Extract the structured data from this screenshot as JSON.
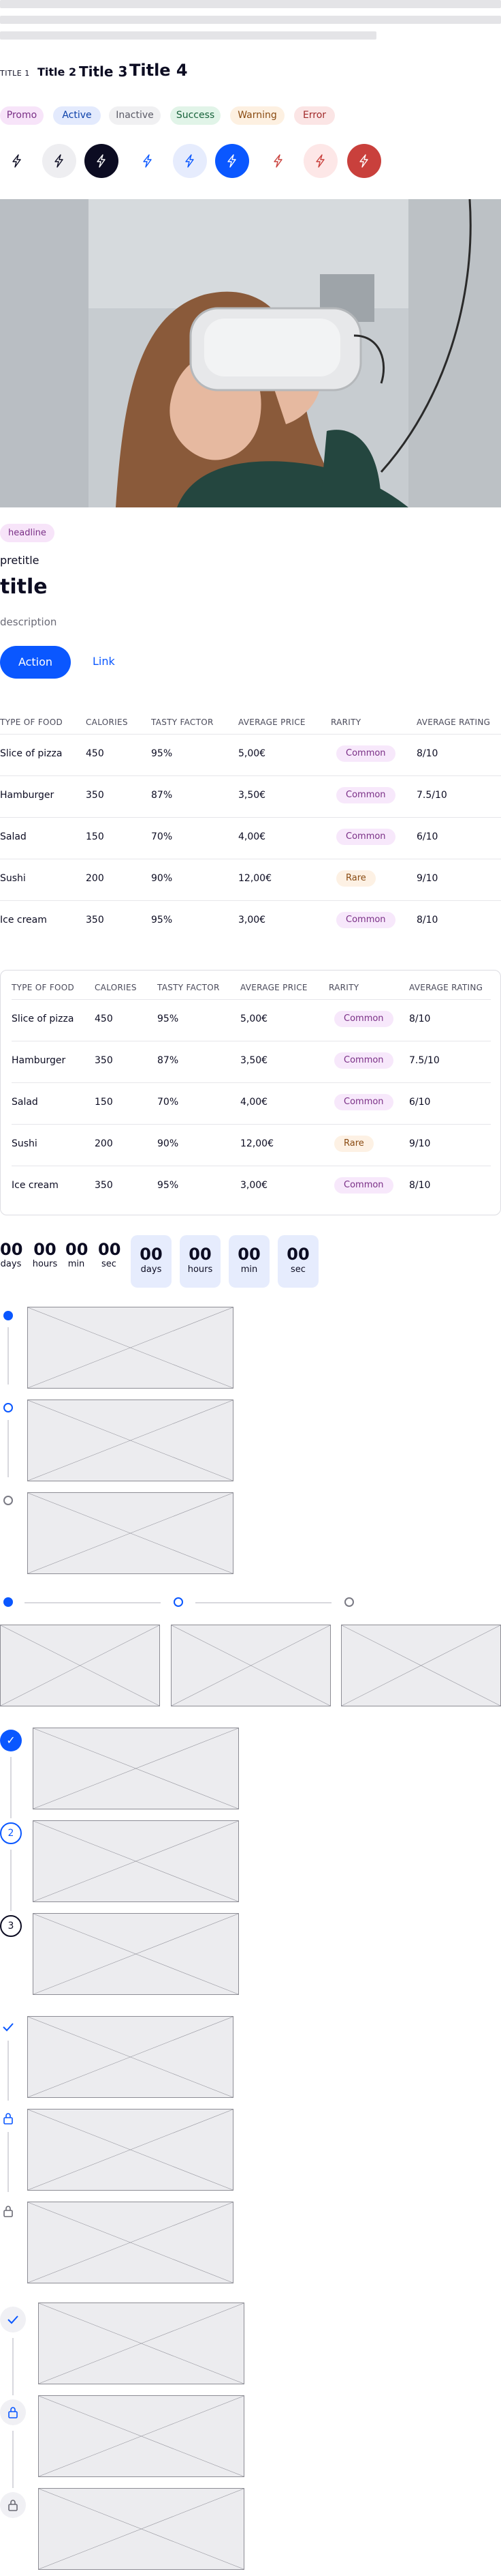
{
  "colors": {
    "primary": "#0a57ff",
    "dark": "#0c0c22",
    "danger": "#c9403c",
    "danger_light": "#fde7e7",
    "primary_light": "#e6ecfd"
  },
  "titles": {
    "t1": "TITLE 1",
    "t2": "Title 2",
    "t3": "Title 3",
    "t4": "Title 4"
  },
  "badges": [
    "Promo",
    "Active",
    "Inactive",
    "Success",
    "Warning",
    "Error"
  ],
  "icon_buttons": {
    "icon": "lightning-icon",
    "count": 9
  },
  "hero": {
    "image": "woman-wearing-vr-headset-photo"
  },
  "card": {
    "headline": "headline",
    "pretitle": "pretitle",
    "title": "title",
    "description": "description",
    "action": "Action",
    "link": "Link"
  },
  "table": {
    "columns": [
      "TYPE OF FOOD",
      "CALORIES",
      "TASTY FACTOR",
      "AVERAGE PRICE",
      "RARITY",
      "AVERAGE RATING"
    ],
    "rows": [
      [
        "Slice of pizza",
        "450",
        "95%",
        "5,00€",
        "Common",
        "8/10"
      ],
      [
        "Hamburger",
        "350",
        "87%",
        "3,50€",
        "Common",
        "7.5/10"
      ],
      [
        "Salad",
        "150",
        "70%",
        "4,00€",
        "Common",
        "6/10"
      ],
      [
        "Sushi",
        "200",
        "90%",
        "12,00€",
        "Rare",
        "9/10"
      ],
      [
        "Ice cream",
        "350",
        "95%",
        "3,00€",
        "Common",
        "8/10"
      ]
    ]
  },
  "countdown": {
    "values": [
      "00",
      "00",
      "00",
      "00"
    ],
    "labels": [
      "days",
      "hours",
      "min",
      "sec"
    ]
  },
  "stepper": {
    "steps": [
      "✓",
      "2",
      "3"
    ]
  }
}
